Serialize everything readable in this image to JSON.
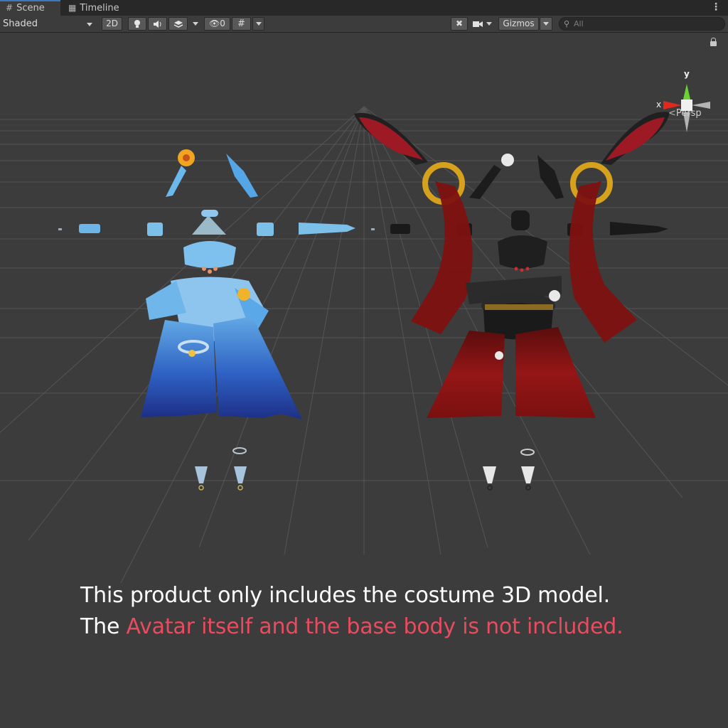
{
  "tabs": [
    {
      "label": "Scene",
      "icon": "grid-icon",
      "active": true
    },
    {
      "label": "Timeline",
      "icon": "timeline-icon",
      "active": false
    }
  ],
  "toolbar": {
    "draw_mode": "Shaded",
    "toggle_2d": "2D",
    "hidden_count": "0",
    "gizmos_label": "Gizmos",
    "search_placeholder": "All"
  },
  "gizmo": {
    "x_label": "x",
    "y_label": "y",
    "projection": "Persp",
    "colors": {
      "x": "#e0281f",
      "y": "#6cd232",
      "z": "#b0b0b0"
    }
  },
  "caption": {
    "line1": "This product only includes the costume 3D model.",
    "line2_prefix": "The ",
    "line2_highlight": "Avatar itself and the base body is not included."
  },
  "colors": {
    "background": "#3c3c3c",
    "highlight": "#e74c5f",
    "blue_costume": "#2e63c8",
    "red_costume": "#8e1414",
    "gold": "#d6a21e"
  }
}
